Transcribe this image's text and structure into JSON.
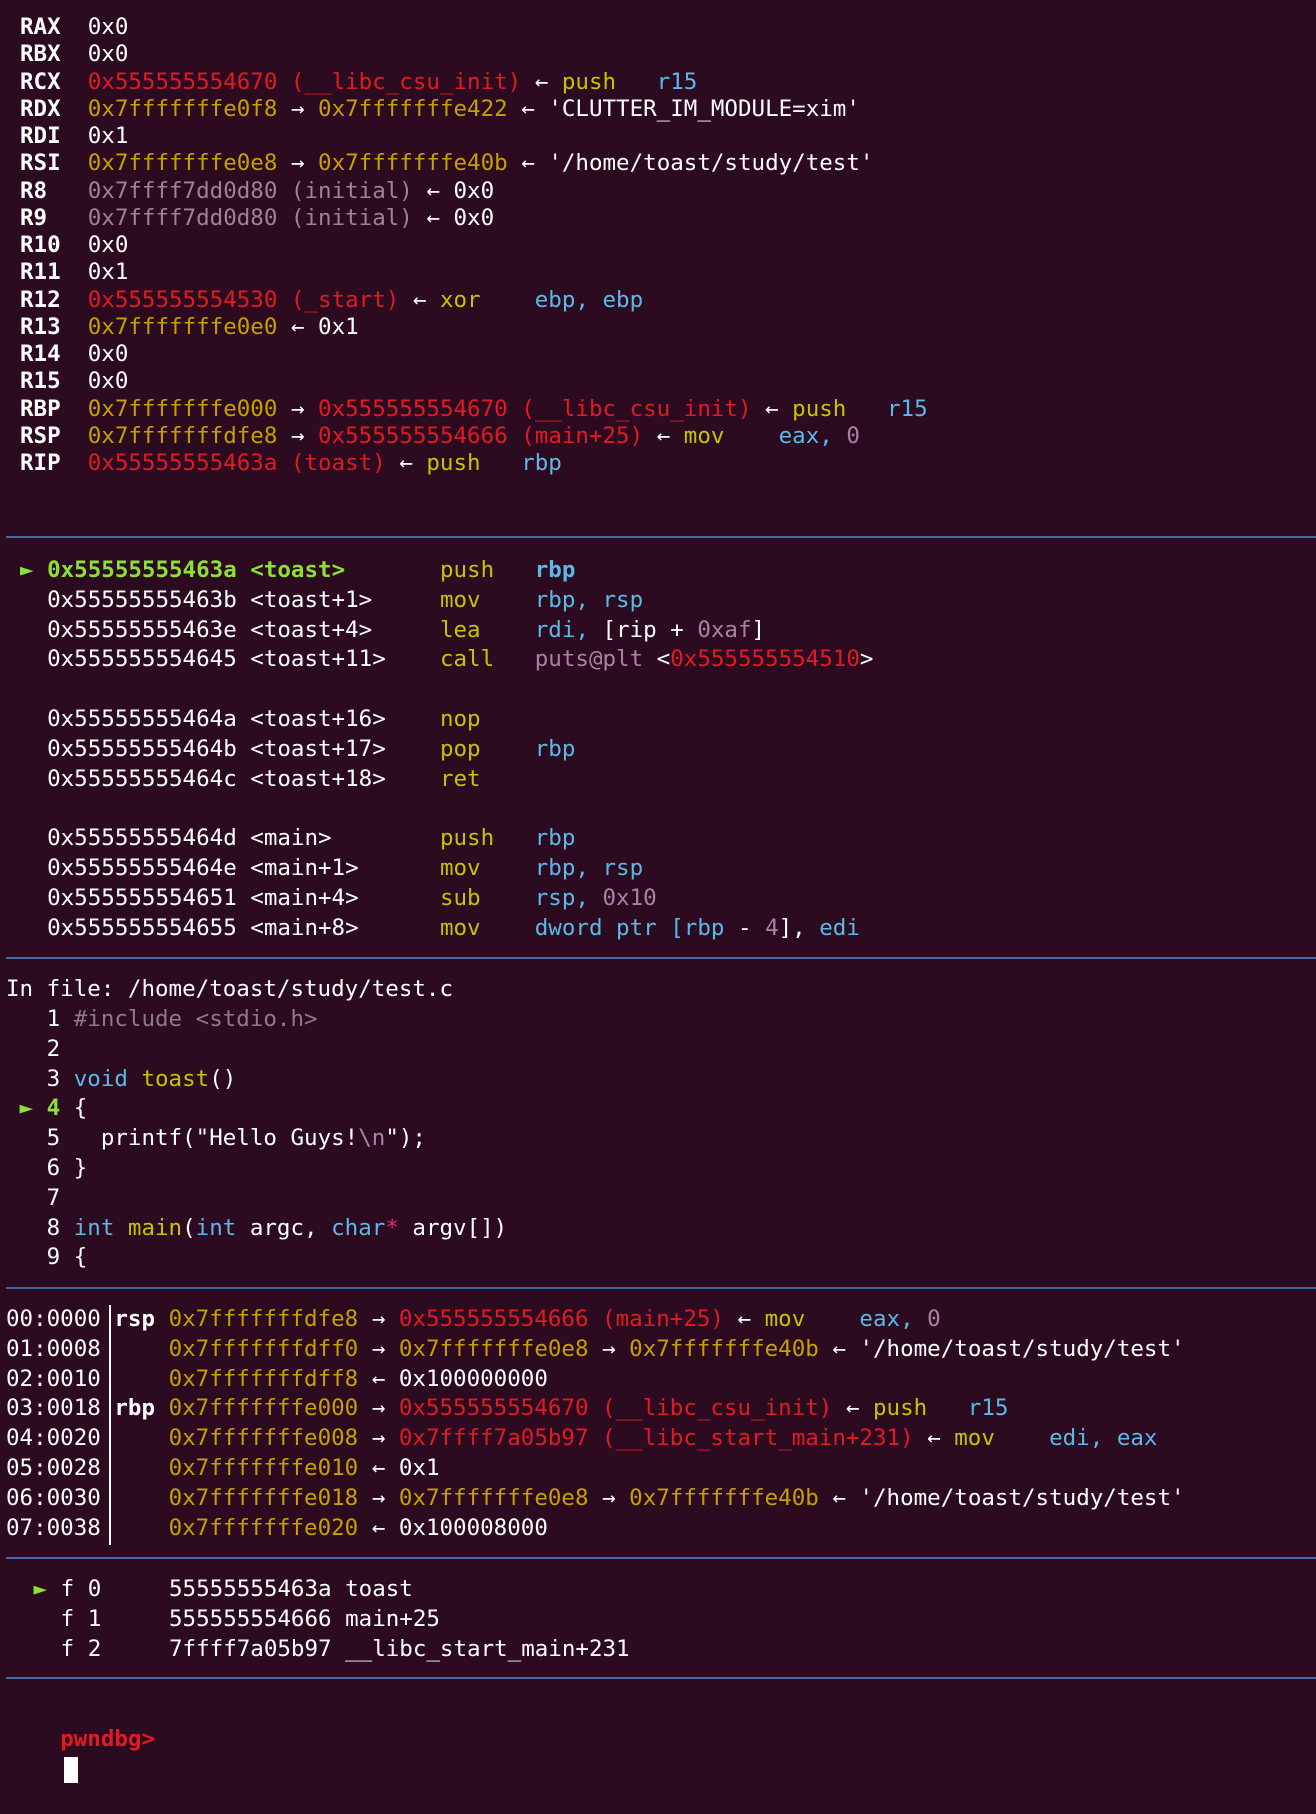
{
  "colors": {
    "background": "#2c0b20",
    "separator": "#3d6aa3",
    "address_code": "#e01b24",
    "address_stack": "#c4a000",
    "mnemonic": "#c4c400",
    "register_operand": "#5cb8e6",
    "immediate": "#ad7fa8",
    "current_marker": "#8ae234",
    "prompt": "#e01b24"
  },
  "registers": [
    [
      [
        "RAX",
        "bold"
      ],
      [
        "  0x0",
        "white"
      ]
    ],
    [
      [
        "RBX",
        "bold"
      ],
      [
        "  0x0",
        "white"
      ]
    ],
    [
      [
        "RCX",
        "bold"
      ],
      [
        "  0x555555554670 (__libc_csu_init)",
        "red"
      ],
      [
        " ← ",
        "white"
      ],
      [
        "push",
        "olive"
      ],
      [
        "   r15",
        "blue"
      ]
    ],
    [
      [
        "RDX",
        "bold"
      ],
      [
        "  0x7fffffffe0f8",
        "yellow"
      ],
      [
        " → ",
        "white"
      ],
      [
        "0x7fffffffe422",
        "yellow"
      ],
      [
        " ← 'CLUTTER_IM_MODULE=xim'",
        "white"
      ]
    ],
    [
      [
        "RDI",
        "bold"
      ],
      [
        "  0x1",
        "white"
      ]
    ],
    [
      [
        "RSI",
        "bold"
      ],
      [
        "  0x7fffffffe0e8",
        "yellow"
      ],
      [
        " → ",
        "white"
      ],
      [
        "0x7fffffffe40b",
        "yellow"
      ],
      [
        " ← '/home/toast/study/test'",
        "white"
      ]
    ],
    [
      [
        "R8 ",
        "bold"
      ],
      [
        "  0x7ffff7dd0d80 (initial)",
        "dim"
      ],
      [
        " ← 0x0",
        "white"
      ]
    ],
    [
      [
        "R9 ",
        "bold"
      ],
      [
        "  0x7ffff7dd0d80 (initial)",
        "dim"
      ],
      [
        " ← 0x0",
        "white"
      ]
    ],
    [
      [
        "R10",
        "bold"
      ],
      [
        "  0x0",
        "white"
      ]
    ],
    [
      [
        "R11",
        "bold"
      ],
      [
        "  0x1",
        "white"
      ]
    ],
    [
      [
        "R12",
        "bold"
      ],
      [
        "  0x555555554530 (_start)",
        "red"
      ],
      [
        " ← ",
        "white"
      ],
      [
        "xor",
        "olive"
      ],
      [
        "    ebp, ebp",
        "blue"
      ]
    ],
    [
      [
        "R13",
        "bold"
      ],
      [
        "  0x7fffffffe0e0",
        "yellow"
      ],
      [
        " ← 0x1",
        "white"
      ]
    ],
    [
      [
        "R14",
        "bold"
      ],
      [
        "  0x0",
        "white"
      ]
    ],
    [
      [
        "R15",
        "bold"
      ],
      [
        "  0x0",
        "white"
      ]
    ],
    [
      [
        "RBP",
        "bold"
      ],
      [
        "  0x7fffffffe000",
        "yellow"
      ],
      [
        " → ",
        "white"
      ],
      [
        "0x555555554670 (__libc_csu_init)",
        "red"
      ],
      [
        " ← ",
        "white"
      ],
      [
        "push",
        "olive"
      ],
      [
        "   r15",
        "blue"
      ]
    ],
    [
      [
        "RSP",
        "bold"
      ],
      [
        "  0x7fffffffdfe8",
        "yellow"
      ],
      [
        " → ",
        "white"
      ],
      [
        "0x555555554666 (main+25)",
        "red"
      ],
      [
        " ← ",
        "white"
      ],
      [
        "mov",
        "olive"
      ],
      [
        "    eax, ",
        "blue"
      ],
      [
        "0",
        "purple"
      ]
    ],
    [
      [
        "RIP",
        "bold"
      ],
      [
        "  0x55555555463a (toast)",
        "red"
      ],
      [
        " ← ",
        "white"
      ],
      [
        "push",
        "olive"
      ],
      [
        "   rbp",
        "blue"
      ]
    ]
  ],
  "disassembly": [
    [
      [
        "► ",
        "green"
      ],
      [
        "0x55555555463a <toast>       ",
        "green-bold"
      ],
      [
        "push",
        "olive"
      ],
      [
        "   rbp",
        "blue-bold"
      ]
    ],
    [
      [
        "  0x55555555463b <toast+1>     ",
        "white"
      ],
      [
        "mov",
        "olive"
      ],
      [
        "    rbp, rsp",
        "blue"
      ]
    ],
    [
      [
        "  0x55555555463e <toast+4>     ",
        "white"
      ],
      [
        "lea",
        "olive"
      ],
      [
        "    rdi, ",
        "blue"
      ],
      [
        "[rip + ",
        "white"
      ],
      [
        "0xaf",
        "purple"
      ],
      [
        "]",
        "white"
      ]
    ],
    [
      [
        "  0x555555554645 <toast+11>    ",
        "white"
      ],
      [
        "call",
        "olive"
      ],
      [
        "   ",
        "white"
      ],
      [
        "puts@plt",
        "purple"
      ],
      [
        " <",
        "white"
      ],
      [
        "0x555555554510",
        "red"
      ],
      [
        ">",
        "white"
      ]
    ],
    [
      [
        "",
        "white"
      ]
    ],
    [
      [
        "  0x55555555464a <toast+16>    ",
        "white"
      ],
      [
        "nop",
        "olive"
      ]
    ],
    [
      [
        "  0x55555555464b <toast+17>    ",
        "white"
      ],
      [
        "pop",
        "olive"
      ],
      [
        "    rbp",
        "blue"
      ]
    ],
    [
      [
        "  0x55555555464c <toast+18>    ",
        "white"
      ],
      [
        "ret",
        "olive"
      ]
    ],
    [
      [
        "",
        "white"
      ]
    ],
    [
      [
        "  0x55555555464d <main>        ",
        "white"
      ],
      [
        "push",
        "olive"
      ],
      [
        "   rbp",
        "blue"
      ]
    ],
    [
      [
        "  0x55555555464e <main+1>      ",
        "white"
      ],
      [
        "mov",
        "olive"
      ],
      [
        "    rbp, rsp",
        "blue"
      ]
    ],
    [
      [
        "  0x555555554651 <main+4>      ",
        "white"
      ],
      [
        "sub",
        "olive"
      ],
      [
        "    rsp, ",
        "blue"
      ],
      [
        "0x10",
        "purple"
      ]
    ],
    [
      [
        "  0x555555554655 <main+8>      ",
        "white"
      ],
      [
        "mov",
        "olive"
      ],
      [
        "    dword ptr [",
        "blue"
      ],
      [
        "rbp",
        "blue"
      ],
      [
        " - ",
        "white"
      ],
      [
        "4",
        "purple"
      ],
      [
        "], ",
        "white"
      ],
      [
        "edi",
        "blue"
      ]
    ]
  ],
  "source": {
    "header": "In file: /home/toast/study/test.c",
    "lines": [
      [
        [
          "   1 ",
          "white"
        ],
        [
          "#include <stdio.h>",
          "gray"
        ]
      ],
      [
        [
          "   2",
          "white"
        ]
      ],
      [
        [
          "   3 ",
          "white"
        ],
        [
          "void",
          "blue"
        ],
        [
          " ",
          "white"
        ],
        [
          "toast",
          "olive"
        ],
        [
          "()",
          "white"
        ]
      ],
      [
        [
          " ► ",
          "green"
        ],
        [
          "4 ",
          "green-bold"
        ],
        [
          "{",
          "white"
        ]
      ],
      [
        [
          "   5   ",
          "white"
        ],
        [
          "printf",
          "white"
        ],
        [
          "(\"Hello Guys!",
          "white"
        ],
        [
          "\\n",
          "purple"
        ],
        [
          "\");",
          "white"
        ]
      ],
      [
        [
          "   6 }",
          "white"
        ]
      ],
      [
        [
          "   7",
          "white"
        ]
      ],
      [
        [
          "   8 ",
          "white"
        ],
        [
          "int",
          "blue"
        ],
        [
          " ",
          "white"
        ],
        [
          "main",
          "olive"
        ],
        [
          "(",
          "white"
        ],
        [
          "int",
          "blue"
        ],
        [
          " argc, ",
          "white"
        ],
        [
          "char",
          "blue"
        ],
        [
          "*",
          "pink"
        ],
        [
          " argv[])",
          "white"
        ]
      ],
      [
        [
          "   9 {",
          "white"
        ]
      ]
    ]
  },
  "stack": [
    [
      [
        "00:0000 ",
        "white"
      ],
      [
        "rsp ",
        "bold"
      ],
      [
        "0x7fffffffdfe8",
        "yellow"
      ],
      [
        " → ",
        "white"
      ],
      [
        "0x555555554666 (main+25)",
        "red"
      ],
      [
        " ← ",
        "white"
      ],
      [
        "mov",
        "olive"
      ],
      [
        "    eax, ",
        "blue"
      ],
      [
        "0",
        "purple"
      ]
    ],
    [
      [
        "01:0008     ",
        "white"
      ],
      [
        "0x7fffffffdff0",
        "yellow"
      ],
      [
        " → ",
        "white"
      ],
      [
        "0x7fffffffe0e8",
        "yellow"
      ],
      [
        " → ",
        "white"
      ],
      [
        "0x7fffffffe40b",
        "yellow"
      ],
      [
        " ← '/home/toast/study/test'",
        "white"
      ]
    ],
    [
      [
        "02:0010     ",
        "white"
      ],
      [
        "0x7fffffffdff8",
        "yellow"
      ],
      [
        " ← 0x100000000",
        "white"
      ]
    ],
    [
      [
        "03:0018 ",
        "white"
      ],
      [
        "rbp ",
        "bold"
      ],
      [
        "0x7fffffffe000",
        "yellow"
      ],
      [
        " → ",
        "white"
      ],
      [
        "0x555555554670 (__libc_csu_init)",
        "red"
      ],
      [
        " ← ",
        "white"
      ],
      [
        "push",
        "olive"
      ],
      [
        "   r15",
        "blue"
      ]
    ],
    [
      [
        "04:0020     ",
        "white"
      ],
      [
        "0x7fffffffe008",
        "yellow"
      ],
      [
        " → ",
        "white"
      ],
      [
        "0x7ffff7a05b97 (__libc_start_main+231)",
        "red"
      ],
      [
        " ← ",
        "white"
      ],
      [
        "mov",
        "olive"
      ],
      [
        "    edi, eax",
        "blue"
      ]
    ],
    [
      [
        "05:0028     ",
        "white"
      ],
      [
        "0x7fffffffe010",
        "yellow"
      ],
      [
        " ← 0x1",
        "white"
      ]
    ],
    [
      [
        "06:0030     ",
        "white"
      ],
      [
        "0x7fffffffe018",
        "yellow"
      ],
      [
        " → ",
        "white"
      ],
      [
        "0x7fffffffe0e8",
        "yellow"
      ],
      [
        " → ",
        "white"
      ],
      [
        "0x7fffffffe40b",
        "yellow"
      ],
      [
        " ← '/home/toast/study/test'",
        "white"
      ]
    ],
    [
      [
        "07:0038     ",
        "white"
      ],
      [
        "0x7fffffffe020",
        "yellow"
      ],
      [
        " ← 0x100008000",
        "white"
      ]
    ]
  ],
  "backtrace": [
    [
      [
        " ►",
        "green"
      ],
      [
        " f 0     55555555463a toast",
        "white"
      ]
    ],
    [
      [
        "   f 1     555555554666 main+25",
        "white"
      ]
    ],
    [
      [
        "   f 2     7ffff7a05b97 __libc_start_main+231",
        "white"
      ]
    ]
  ],
  "prompt": "pwndbg>"
}
